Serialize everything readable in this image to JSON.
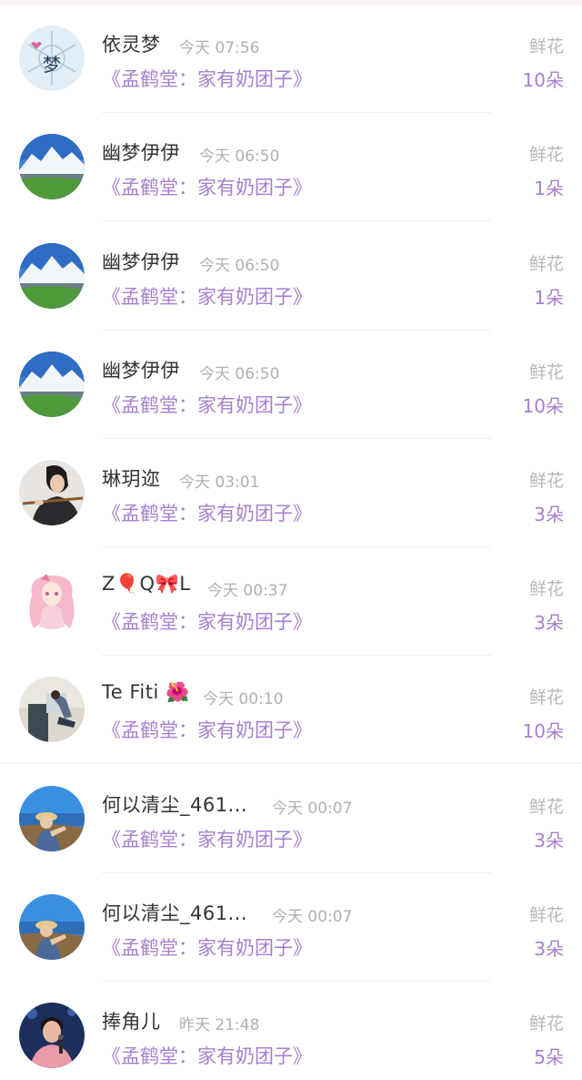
{
  "rows": [
    {
      "name": "依灵梦",
      "time": "今天 07:56",
      "book": "《孟鹤堂：家有奶团子》",
      "gift": "鲜花",
      "count": "10朵",
      "avatar": "snowflake-avatar",
      "avatar_text": "梦"
    },
    {
      "name": "幽梦伊伊",
      "time": "今天 06:50",
      "book": "《孟鹤堂：家有奶团子》",
      "gift": "鲜花",
      "count": "1朵",
      "avatar": "mountain-avatar"
    },
    {
      "name": "幽梦伊伊",
      "time": "今天 06:50",
      "book": "《孟鹤堂：家有奶团子》",
      "gift": "鲜花",
      "count": "1朵",
      "avatar": "mountain-avatar"
    },
    {
      "name": "幽梦伊伊",
      "time": "今天 06:50",
      "book": "《孟鹤堂：家有奶团子》",
      "gift": "鲜花",
      "count": "10朵",
      "avatar": "mountain-avatar"
    },
    {
      "name": "琳玥迩",
      "time": "今天 03:01",
      "book": "《孟鹤堂：家有奶团子》",
      "gift": "鲜花",
      "count": "3朵",
      "avatar": "flute-player-avatar"
    },
    {
      "name": "Z🎈Q🎀L",
      "time": "今天 00:37",
      "book": "《孟鹤堂：家有奶团子》",
      "gift": "鲜花",
      "count": "3朵",
      "avatar": "anime-girl-avatar"
    },
    {
      "name": "Te Fiti 🌺",
      "time": "今天 00:10",
      "book": "《孟鹤堂：家有奶团子》",
      "gift": "鲜花",
      "count": "10朵",
      "avatar": "sitting-figure-avatar"
    },
    {
      "name": "何以清尘_461...",
      "time": "今天 00:07",
      "book": "《孟鹤堂：家有奶团子》",
      "gift": "鲜花",
      "count": "3朵",
      "avatar": "seaside-girl-avatar"
    },
    {
      "name": "何以清尘_461...",
      "time": "今天 00:07",
      "book": "《孟鹤堂：家有奶团子》",
      "gift": "鲜花",
      "count": "3朵",
      "avatar": "seaside-girl-avatar"
    },
    {
      "name": "捧角儿",
      "time": "昨天 21:48",
      "book": "《孟鹤堂：家有奶团子》",
      "gift": "鲜花",
      "count": "5朵",
      "avatar": "singer-avatar"
    }
  ],
  "colors": {
    "name": "#333333",
    "time": "#b0b0b0",
    "book": "#a77fcf",
    "count": "#a77fcf",
    "gift": "#b8b8b8"
  }
}
